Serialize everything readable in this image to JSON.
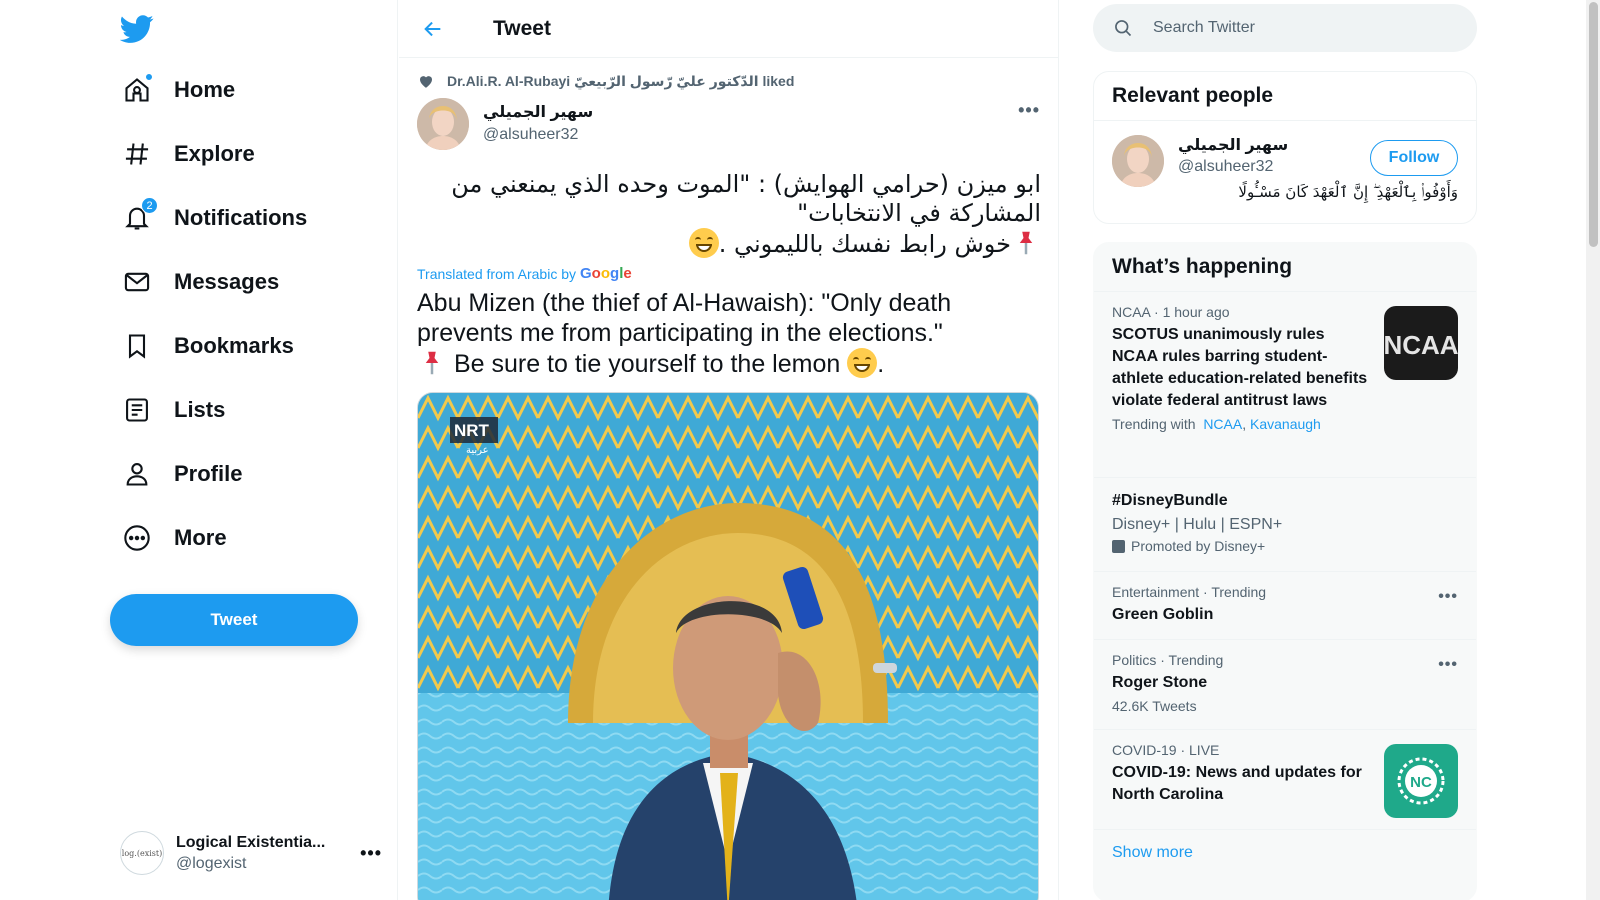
{
  "nav": {
    "items": [
      {
        "label": "Home",
        "icon": "home-icon"
      },
      {
        "label": "Explore",
        "icon": "hashtag-icon"
      },
      {
        "label": "Notifications",
        "icon": "bell-icon",
        "badge": "2"
      },
      {
        "label": "Messages",
        "icon": "envelope-icon"
      },
      {
        "label": "Bookmarks",
        "icon": "bookmark-icon"
      },
      {
        "label": "Lists",
        "icon": "list-icon"
      },
      {
        "label": "Profile",
        "icon": "person-icon"
      },
      {
        "label": "More",
        "icon": "more-circle-icon"
      }
    ],
    "tweet_button": "Tweet",
    "account": {
      "avatar_text": "log.(exist)",
      "name": "Logical Existentia...",
      "handle": "@logexist"
    }
  },
  "main": {
    "title": "Tweet",
    "social_context": "Dr.Ali.R. Al-Rubayi الدّكتور عليّ رّسول الرّبيعيّ liked",
    "tweet": {
      "author_name": "سهير الجميلي",
      "author_handle": "@alsuheer32",
      "arabic_line1": "ابو ميزن (حرامي الهوايش) : \"الموت وحده الذي يمنعني من المشاركة في الانتخابات\"",
      "arabic_line2": "خوش رابط نفسك بالليموني .",
      "translated_label": "Translated from Arabic by",
      "translator": "Google",
      "english_line1": "Abu Mizen (the thief of Al-Hawaish): \"Only death prevents me from participating in the elections.\"",
      "english_line2": " Be sure to tie yourself to the lemon ",
      "english_end": ".",
      "media_watermark": "NRT",
      "media_watermark_sub": "عربية"
    }
  },
  "search": {
    "placeholder": "Search Twitter"
  },
  "relevant": {
    "title": "Relevant people",
    "person": {
      "name": "سهير الجميلي",
      "handle": "@alsuheer32",
      "bio": "وَأَوْفُوا۟ بِٱلْعَهْدِ ۖ إِنَّ ٱلْعَهْدَ كَانَ مَسْـُٔولًا",
      "follow_label": "Follow"
    }
  },
  "trends": {
    "title": "What’s happening",
    "items": [
      {
        "meta": "NCAA · 1 hour ago",
        "title": "SCOTUS unanimously rules NCAA rules barring student-athlete education-related benefits violate federal antitrust laws",
        "with_label": "Trending with",
        "links": [
          "NCAA",
          "Kavanaugh"
        ],
        "thumb_text": "NCAA"
      },
      {
        "title": "#DisneyBundle",
        "desc": "Disney+ | Hulu | ESPN+",
        "promoted": "Promoted by Disney+"
      },
      {
        "meta": "Entertainment · Trending",
        "title": "Green Goblin"
      },
      {
        "meta": "Politics · Trending",
        "title": "Roger Stone",
        "count": "42.6K Tweets"
      },
      {
        "meta": "COVID-19 · LIVE",
        "title": "COVID-19: News and updates for North Carolina",
        "thumb_text": "NC"
      }
    ],
    "show_more": "Show more"
  },
  "colors": {
    "accent": "#1d9bf0",
    "text": "#0f1419",
    "muted": "#536471"
  }
}
